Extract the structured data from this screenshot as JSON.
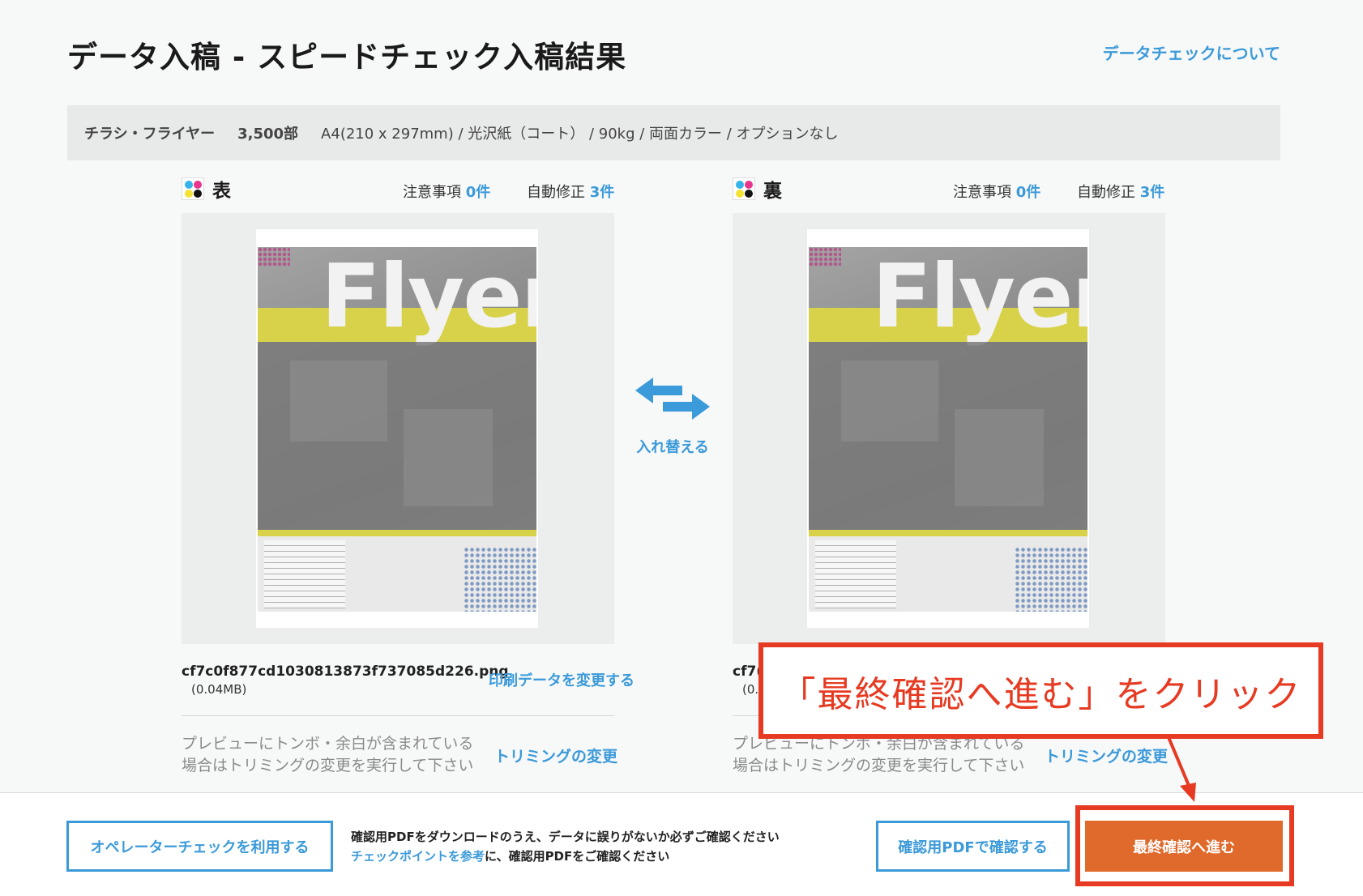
{
  "header": {
    "title": "データ入稿 - スピードチェック入稿結果",
    "about_link": "データチェックについて"
  },
  "spec": {
    "product": "チラシ・フライヤー",
    "quantity": "3,500部",
    "details": "A4(210 x 297mm) / 光沢紙（コート） / 90kg / 両面カラー / オプションなし"
  },
  "front": {
    "label": "表",
    "caution_label": "注意事項",
    "caution_count": "0件",
    "autofix_label": "自動修正",
    "autofix_count": "3件",
    "preview_word": "Flyer",
    "filename": "cf7c0f877cd1030813873f737085d226.png",
    "filesize": "(0.04MB)",
    "change_data": "印刷データを変更する",
    "hint_line1": "プレビューにトンボ・余白が含まれている",
    "hint_line2": "場合はトリミングの変更を実行して下さい",
    "trim_link": "トリミングの変更"
  },
  "back": {
    "label": "裏",
    "caution_label": "注意事項",
    "caution_count": "0件",
    "autofix_label": "自動修正",
    "autofix_count": "3件",
    "preview_word": "Flyer",
    "filename_fragment": "cf7(",
    "filesize_fragment": "(0.",
    "hint_line1": "プレビューにトンボ・余白が含まれている",
    "hint_line2": "場合はトリミングの変更を実行して下さい",
    "trim_link": "トリミングの変更"
  },
  "swap": {
    "label": "入れ替える"
  },
  "footer": {
    "operator_check": "オペレーターチェックを利用する",
    "note_line1": "確認用PDFをダウンロードのうえ、データに誤りがないか必ずご確認ください",
    "note_link": "チェックポイントを参考",
    "note_line2_rest": "に、確認用PDFをご確認ください",
    "confirm_pdf": "確認用PDFで確認する",
    "final_confirm": "最終確認へ進む"
  },
  "annotation": {
    "callout_text": "「最終確認へ進む」をクリック"
  },
  "colors": {
    "accent_blue": "#3b9ad9",
    "primary_orange": "#e06a2c",
    "annotation_red": "#e63a22"
  }
}
